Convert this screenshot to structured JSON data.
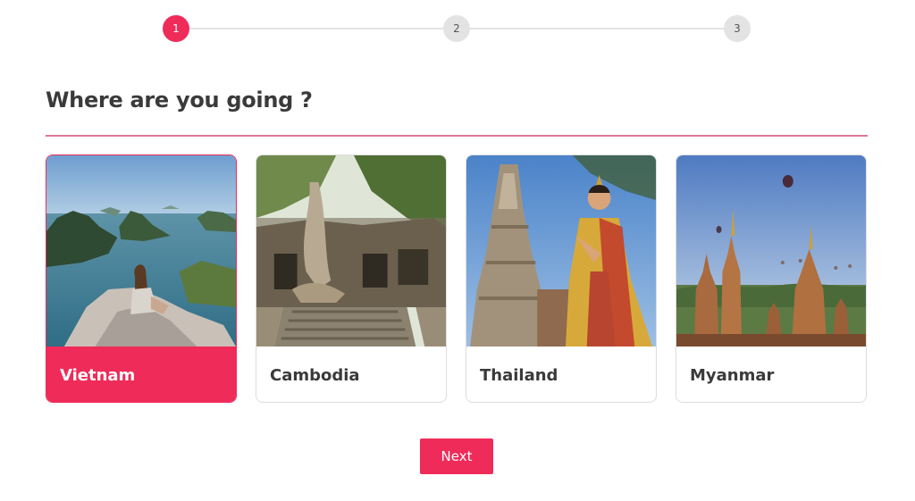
{
  "stepper": {
    "steps": [
      {
        "label": "1",
        "active": true
      },
      {
        "label": "2",
        "active": false
      },
      {
        "label": "3",
        "active": false
      }
    ],
    "active_color": "#ef2b59",
    "inactive_color": "#e3e3e3"
  },
  "main": {
    "title": "Where are you going ?"
  },
  "destinations": [
    {
      "label": "Vietnam",
      "selected": true,
      "image": "vietnam-bay-photo"
    },
    {
      "label": "Cambodia",
      "selected": false,
      "image": "cambodia-temple-photo"
    },
    {
      "label": "Thailand",
      "selected": false,
      "image": "thailand-temple-photo"
    },
    {
      "label": "Myanmar",
      "selected": false,
      "image": "myanmar-pagodas-photo"
    }
  ],
  "actions": {
    "next_label": "Next"
  },
  "colors": {
    "accent": "#ef2b59",
    "text": "#3a3a3a"
  }
}
